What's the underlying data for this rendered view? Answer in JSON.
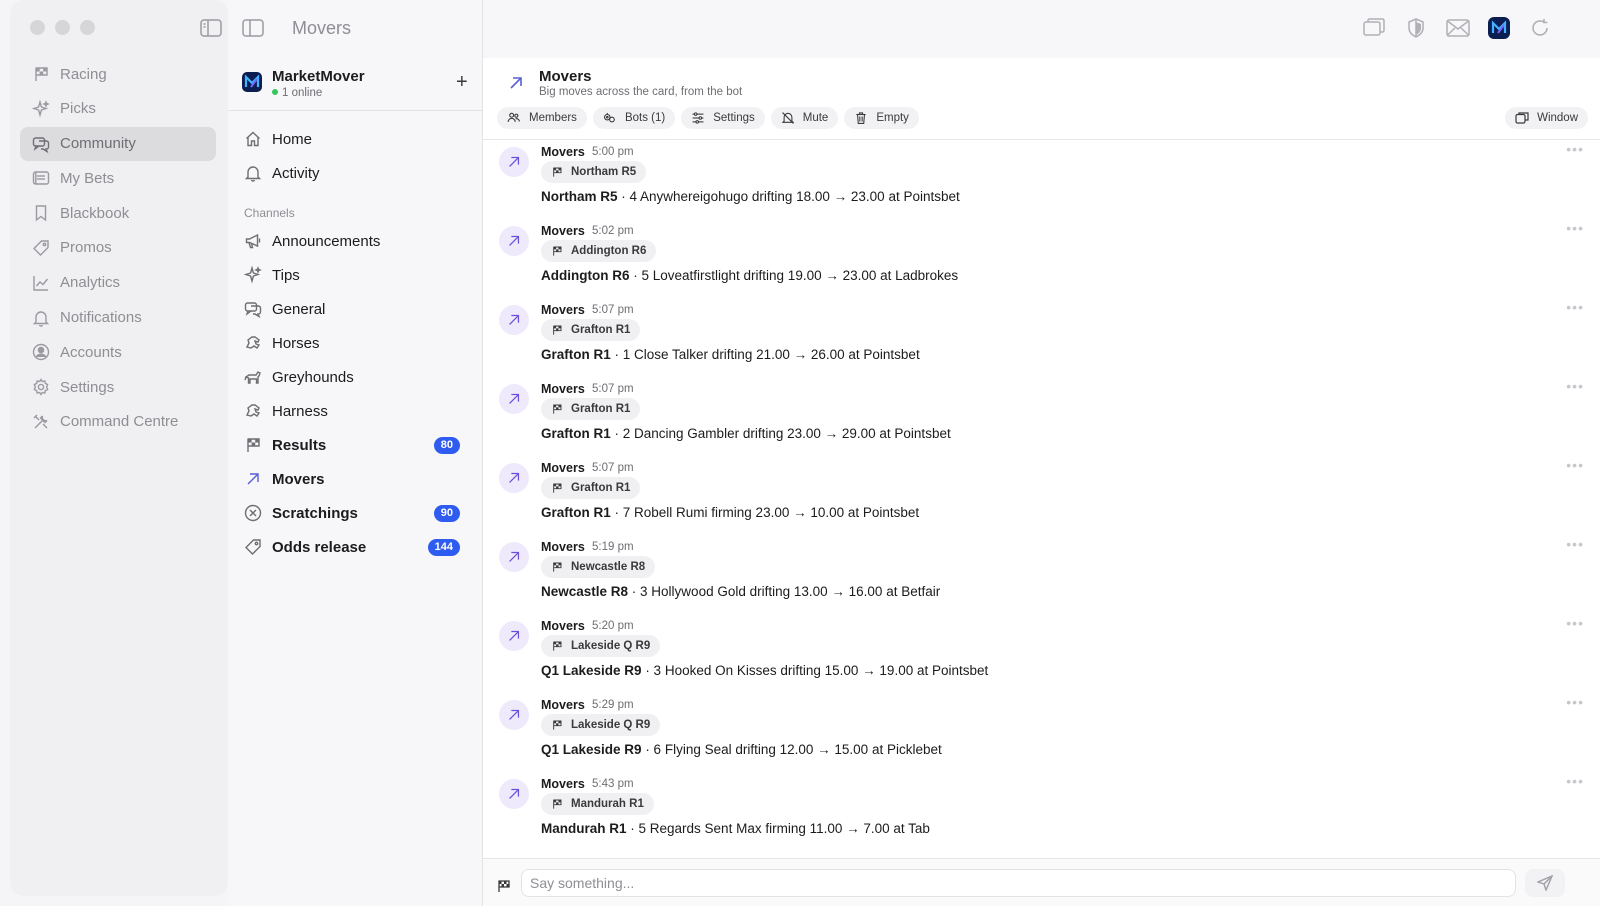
{
  "app": {
    "title": "Movers"
  },
  "left_nav": {
    "items": [
      {
        "label": "Racing",
        "icon": "flag-icon"
      },
      {
        "label": "Picks",
        "icon": "sparkle-icon"
      },
      {
        "label": "Community",
        "icon": "chat-bubbles-icon",
        "active": true
      },
      {
        "label": "My Bets",
        "icon": "ticket-icon"
      },
      {
        "label": "Blackbook",
        "icon": "bookmark-icon"
      },
      {
        "label": "Promos",
        "icon": "tag-icon"
      },
      {
        "label": "Analytics",
        "icon": "line-chart-icon"
      },
      {
        "label": "Notifications",
        "icon": "bell-icon"
      },
      {
        "label": "Accounts",
        "icon": "user-circle-icon"
      },
      {
        "label": "Settings",
        "icon": "gear-icon"
      },
      {
        "label": "Command Centre",
        "icon": "tools-icon"
      }
    ]
  },
  "server": {
    "name": "MarketMover",
    "online": "1 online",
    "add_label": "+"
  },
  "channels": {
    "top": [
      {
        "label": "Home",
        "icon": "home-icon"
      },
      {
        "label": "Activity",
        "icon": "bell-icon"
      }
    ],
    "section_label": "Channels",
    "items": [
      {
        "label": "Announcements",
        "icon": "megaphone-icon",
        "bold": false,
        "badge": ""
      },
      {
        "label": "Tips",
        "icon": "sparkle-icon",
        "bold": false,
        "badge": ""
      },
      {
        "label": "General",
        "icon": "chat-bubbles-icon",
        "bold": false,
        "badge": ""
      },
      {
        "label": "Horses",
        "icon": "horse-icon",
        "bold": false,
        "badge": ""
      },
      {
        "label": "Greyhounds",
        "icon": "dog-icon",
        "bold": false,
        "badge": ""
      },
      {
        "label": "Harness",
        "icon": "horse-icon",
        "bold": false,
        "badge": ""
      },
      {
        "label": "Results",
        "icon": "flag-icon",
        "bold": true,
        "badge": "80"
      },
      {
        "label": "Movers",
        "icon": "arrow-up-right-icon",
        "bold": true,
        "badge": ""
      },
      {
        "label": "Scratchings",
        "icon": "x-circle-icon",
        "bold": true,
        "badge": "90"
      },
      {
        "label": "Odds release",
        "icon": "tag-icon",
        "bold": true,
        "badge": "144"
      }
    ]
  },
  "channel_header": {
    "title": "Movers",
    "subtitle": "Big moves across the card, from the bot",
    "actions": [
      {
        "label": "Members",
        "icon": "users-icon"
      },
      {
        "label": "Bots (1)",
        "icon": "bot-icon"
      },
      {
        "label": "Settings",
        "icon": "sliders-icon"
      },
      {
        "label": "Mute",
        "icon": "bell-off-icon"
      },
      {
        "label": "Empty",
        "icon": "trash-icon"
      }
    ],
    "window_label": "Window"
  },
  "messages": [
    {
      "author": "Movers",
      "time": "5:00 pm",
      "tag": "Northam R5",
      "race": "Northam R5",
      "body": " · 4 Anywhereigohugo drifting 18.00 → 23.00 at Pointsbet"
    },
    {
      "author": "Movers",
      "time": "5:02 pm",
      "tag": "Addington R6",
      "race": "Addington R6",
      "body": " · 5 Loveatfirstlight drifting 19.00 → 23.00 at Ladbrokes"
    },
    {
      "author": "Movers",
      "time": "5:07 pm",
      "tag": "Grafton R1",
      "race": "Grafton R1",
      "body": " · 1 Close Talker drifting 21.00 → 26.00 at Pointsbet"
    },
    {
      "author": "Movers",
      "time": "5:07 pm",
      "tag": "Grafton R1",
      "race": "Grafton R1",
      "body": " · 2 Dancing Gambler drifting 23.00 → 29.00 at Pointsbet"
    },
    {
      "author": "Movers",
      "time": "5:07 pm",
      "tag": "Grafton R1",
      "race": "Grafton R1",
      "body": " · 7 Robell Rumi firming 23.00 → 10.00 at Pointsbet"
    },
    {
      "author": "Movers",
      "time": "5:19 pm",
      "tag": "Newcastle R8",
      "race": "Newcastle R8",
      "body": " · 3 Hollywood Gold drifting 13.00 → 16.00 at Betfair"
    },
    {
      "author": "Movers",
      "time": "5:20 pm",
      "tag": "Lakeside Q R9",
      "race": "Q1 Lakeside R9",
      "body": " · 3 Hooked On Kisses drifting 15.00 → 19.00 at Pointsbet"
    },
    {
      "author": "Movers",
      "time": "5:29 pm",
      "tag": "Lakeside Q R9",
      "race": "Q1 Lakeside R9",
      "body": " · 6 Flying Seal drifting 12.00 → 15.00 at Picklebet"
    },
    {
      "author": "Movers",
      "time": "5:43 pm",
      "tag": "Mandurah R1",
      "race": "Mandurah R1",
      "body": " · 5 Regards Sent Max firming 11.00 → 7.00 at Tab"
    }
  ],
  "composer": {
    "placeholder": "Say something...",
    "value": ""
  },
  "colors": {
    "accent": "#2f5cf0",
    "avatar_bg": "#eeeafc",
    "avatar_icon": "#6b4fd8",
    "logo_bg": "#0b1d51"
  }
}
